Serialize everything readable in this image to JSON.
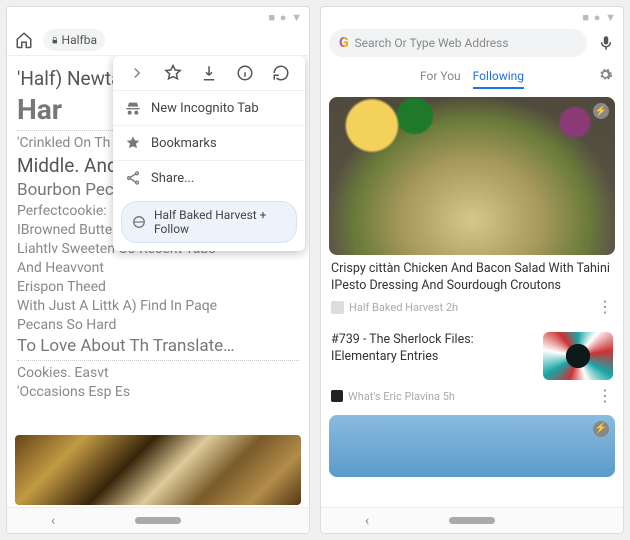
{
  "left": {
    "window_decor": "■ ● ▼",
    "url_display": "Halfba",
    "article": {
      "title_line1": "'Half) Newtab",
      "title_line2": "Har",
      "lines": [
        "'Crinkled On Th",
        "Middle. Andloh Historv",
        "Bourbon Pecan / Downloads",
        "Perfectcookie:",
        "IBrowned Butte",
        "Liahtlv Sweeten Co Recent Tabs",
        "And Heavvont",
        "Erispon Theed",
        "With Just A Littk A) Find In Paqe",
        "Pecans So Hard",
        "To Love About Th Translate…",
        "Cookies. Easvt",
        "'Occasions Esp Es"
      ]
    },
    "menu": {
      "new_incognito": "New Incognito Tab",
      "bookmarks": "Bookmarks",
      "share": "Share...",
      "follow_label": "Half Baked Harvest + Follow"
    }
  },
  "right": {
    "window_decor": "■ ● ▼",
    "search_placeholder": "Search Or Type Web Address",
    "tabs": {
      "for_you": "For You",
      "following": "Following"
    },
    "card1": {
      "title": "Crispy cittàn Chicken And Bacon Salad With Tahini IPesto Dressing And Sourdough Croutons",
      "publisher": "Half Baked Harvest 2h"
    },
    "card2": {
      "title_l1": "#739 - The Sherlock Files:",
      "title_l2": "IElementary Entries",
      "publisher": "What's Eric Plavina 5h"
    }
  }
}
